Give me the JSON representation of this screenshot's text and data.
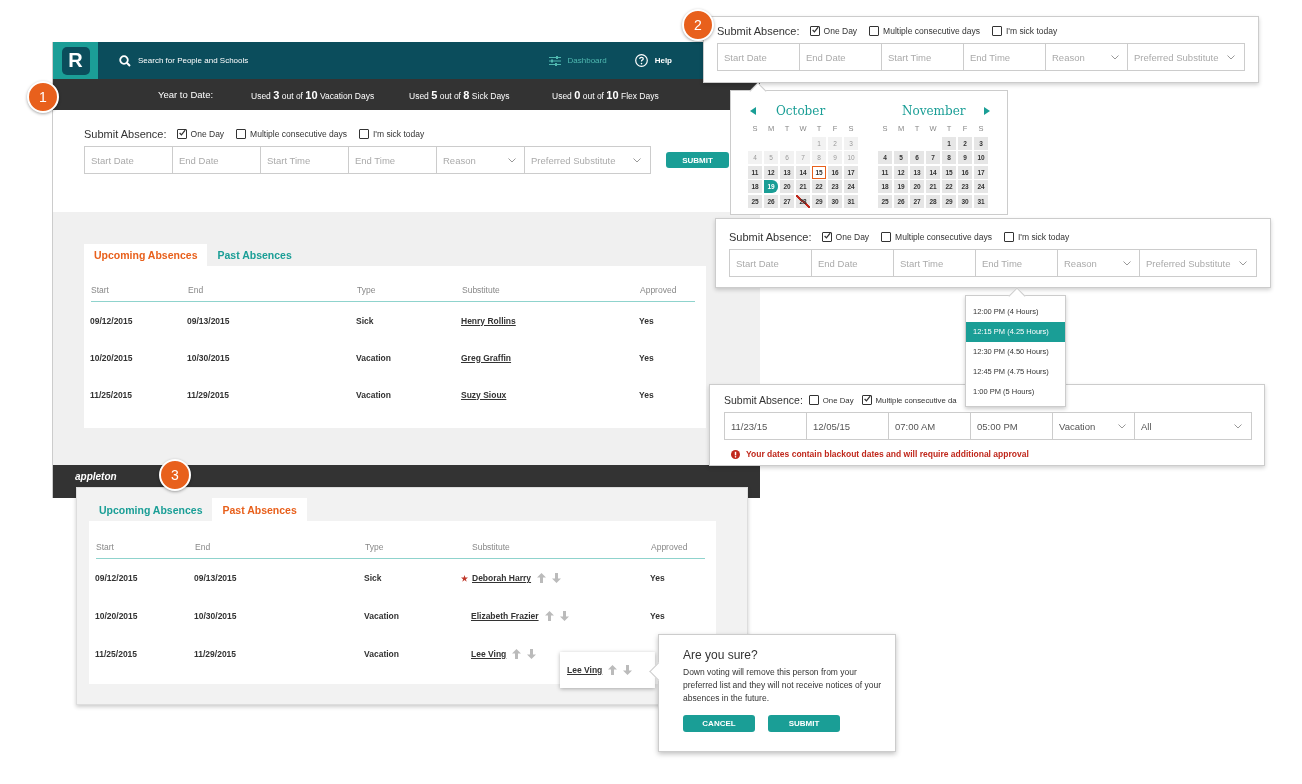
{
  "main_screen": {
    "badge": "1",
    "header": {
      "logo": "R",
      "search": {
        "placeholder": "Search for People and Schools"
      },
      "nav": [
        {
          "label": "Dashboard",
          "kind": "dashboard",
          "selected": true
        },
        {
          "label": "Help",
          "kind": "help",
          "selected": false
        }
      ]
    },
    "stats": {
      "title": "Year to Date:",
      "items": [
        "Used **3** out of **10** Vacation Days",
        "Used **5** out of **8** Sick Days",
        "Used **0** out of **10** Flex Days"
      ]
    },
    "form": {
      "label": "Submit Absence:",
      "options": [
        {
          "label": "One Day",
          "checked": true
        },
        {
          "label": "Multiple consecutive days",
          "checked": false
        },
        {
          "label": "I'm sick today",
          "checked": false
        }
      ],
      "fields": [
        {
          "kind": "text",
          "placeholder": "Start Date"
        },
        {
          "kind": "text",
          "placeholder": "End Date"
        },
        {
          "kind": "text",
          "placeholder": "Start Time"
        },
        {
          "kind": "text",
          "placeholder": "End Time"
        },
        {
          "kind": "select",
          "placeholder": "Reason"
        },
        {
          "kind": "select",
          "placeholder": "Preferred Substitute"
        }
      ],
      "submit": "SUBMIT"
    },
    "tabs": [
      {
        "label": "Upcoming Absences",
        "selected": true
      },
      {
        "label": "Past Absences",
        "selected": false
      }
    ],
    "table": {
      "columns": [
        "Start",
        "End",
        "Type",
        "Substitute",
        "Approved"
      ],
      "rows": [
        {
          "start": "09/12/2015",
          "end": "09/13/2015",
          "type": "Sick",
          "substitute": "Henry Rollins",
          "approved": "Yes"
        },
        {
          "start": "10/20/2015",
          "end": "10/30/2015",
          "type": "Vacation",
          "substitute": "Greg Graffin",
          "approved": "Yes"
        },
        {
          "start": "11/25/2015",
          "end": "11/29/2015",
          "type": "Vacation",
          "substitute": "Suzy Sioux",
          "approved": "Yes"
        }
      ]
    },
    "footer": {
      "logo": "appleton"
    }
  },
  "calendar_form": {
    "badge": "2",
    "form": {
      "label": "Submit Absence:",
      "options": [
        {
          "label": "One Day",
          "checked": true
        },
        {
          "label": "Multiple consecutive days",
          "checked": false
        },
        {
          "label": "I'm sick today",
          "checked": false
        }
      ],
      "fields": [
        {
          "kind": "text",
          "placeholder": "Start Date"
        },
        {
          "kind": "text",
          "placeholder": "End Date"
        },
        {
          "kind": "text",
          "placeholder": "Start Time"
        },
        {
          "kind": "text",
          "placeholder": "End Time"
        },
        {
          "kind": "select",
          "placeholder": "Reason"
        },
        {
          "kind": "select",
          "placeholder": "Preferred Substitute"
        }
      ]
    },
    "calendar": {
      "months": [
        {
          "name": "October",
          "weekdays": [
            "S",
            "M",
            "T",
            "W",
            "T",
            "F",
            "S"
          ],
          "weeks": [
            [
              {
                "day": "1",
                "kind": "disabled",
                "selected": false
              },
              {
                "day": "2",
                "kind": "disabled",
                "selected": false
              },
              {
                "day": "3",
                "kind": "disabled",
                "selected": false
              }
            ],
            [
              {
                "day": "4",
                "kind": "disabled",
                "selected": false
              },
              {
                "day": "5",
                "kind": "disabled",
                "selected": false
              },
              {
                "day": "6",
                "kind": "disabled",
                "selected": false
              },
              {
                "day": "7",
                "kind": "disabled",
                "selected": false
              },
              {
                "day": "8",
                "kind": "disabled",
                "selected": false
              },
              {
                "day": "9",
                "kind": "disabled",
                "selected": false
              },
              {
                "day": "10",
                "kind": "disabled",
                "selected": false
              }
            ],
            [
              {
                "day": "11",
                "kind": "normal",
                "selected": false
              },
              {
                "day": "12",
                "kind": "normal",
                "selected": false
              },
              {
                "day": "13",
                "kind": "normal",
                "selected": false
              },
              {
                "day": "14",
                "kind": "normal",
                "selected": false
              },
              {
                "day": "15",
                "kind": "today",
                "selected": false
              },
              {
                "day": "16",
                "kind": "normal",
                "selected": false
              },
              {
                "day": "17",
                "kind": "normal",
                "selected": false
              }
            ],
            [
              {
                "day": "18",
                "kind": "normal",
                "selected": false
              },
              {
                "day": "19",
                "kind": "normal",
                "selected": true
              },
              {
                "day": "20",
                "kind": "normal",
                "selected": false
              },
              {
                "day": "21",
                "kind": "normal",
                "selected": false
              },
              {
                "day": "22",
                "kind": "normal",
                "selected": false
              },
              {
                "day": "23",
                "kind": "normal",
                "selected": false
              },
              {
                "day": "24",
                "kind": "normal",
                "selected": false
              }
            ],
            [
              {
                "day": "25",
                "kind": "normal",
                "selected": false
              },
              {
                "day": "26",
                "kind": "normal",
                "selected": false
              },
              {
                "day": "27",
                "kind": "normal",
                "selected": false
              },
              {
                "day": "28",
                "kind": "blackout",
                "selected": false
              },
              {
                "day": "29",
                "kind": "normal",
                "selected": false
              },
              {
                "day": "30",
                "kind": "normal",
                "selected": false
              },
              {
                "day": "31",
                "kind": "normal",
                "selected": false
              }
            ]
          ]
        },
        {
          "name": "November",
          "weekdays": [
            "S",
            "M",
            "T",
            "W",
            "T",
            "F",
            "S"
          ],
          "weeks": [
            [
              {
                "day": "1",
                "kind": "normal",
                "selected": false
              },
              {
                "day": "2",
                "kind": "normal",
                "selected": false
              },
              {
                "day": "3",
                "kind": "normal",
                "selected": false
              }
            ],
            [
              {
                "day": "4",
                "kind": "normal",
                "selected": false
              },
              {
                "day": "5",
                "kind": "normal",
                "selected": false
              },
              {
                "day": "6",
                "kind": "normal",
                "selected": false
              },
              {
                "day": "7",
                "kind": "normal",
                "selected": false
              },
              {
                "day": "8",
                "kind": "normal",
                "selected": false
              },
              {
                "day": "9",
                "kind": "normal",
                "selected": false
              },
              {
                "day": "10",
                "kind": "normal",
                "selected": false
              }
            ],
            [
              {
                "day": "11",
                "kind": "normal",
                "selected": false
              },
              {
                "day": "12",
                "kind": "normal",
                "selected": false
              },
              {
                "day": "13",
                "kind": "normal",
                "selected": false
              },
              {
                "day": "14",
                "kind": "normal",
                "selected": false
              },
              {
                "day": "15",
                "kind": "normal",
                "selected": false
              },
              {
                "day": "16",
                "kind": "normal",
                "selected": false
              },
              {
                "day": "17",
                "kind": "normal",
                "selected": false
              }
            ],
            [
              {
                "day": "18",
                "kind": "normal",
                "selected": false
              },
              {
                "day": "19",
                "kind": "normal",
                "selected": false
              },
              {
                "day": "20",
                "kind": "normal",
                "selected": false
              },
              {
                "day": "21",
                "kind": "normal",
                "selected": false
              },
              {
                "day": "22",
                "kind": "normal",
                "selected": false
              },
              {
                "day": "23",
                "kind": "normal",
                "selected": false
              },
              {
                "day": "24",
                "kind": "normal",
                "selected": false
              }
            ],
            [
              {
                "day": "25",
                "kind": "normal",
                "selected": false
              },
              {
                "day": "26",
                "kind": "normal",
                "selected": false
              },
              {
                "day": "27",
                "kind": "normal",
                "selected": false
              },
              {
                "day": "28",
                "kind": "normal",
                "selected": false
              },
              {
                "day": "29",
                "kind": "normal",
                "selected": false
              },
              {
                "day": "30",
                "kind": "normal",
                "selected": false
              },
              {
                "day": "31",
                "kind": "normal",
                "selected": false
              }
            ]
          ]
        }
      ]
    }
  },
  "end_time_form": {
    "form": {
      "label": "Submit Absence:",
      "options": [
        {
          "label": "One Day",
          "checked": true
        },
        {
          "label": "Multiple consecutive days",
          "checked": false
        },
        {
          "label": "I'm sick today",
          "checked": false
        }
      ],
      "fields": [
        {
          "kind": "text",
          "placeholder": "Start Date"
        },
        {
          "kind": "text",
          "placeholder": "End Date"
        },
        {
          "kind": "text",
          "placeholder": "Start Time"
        },
        {
          "kind": "text",
          "placeholder": "End Time"
        },
        {
          "kind": "select",
          "placeholder": "Reason"
        },
        {
          "kind": "select",
          "placeholder": "Preferred Substitute"
        }
      ]
    },
    "time_options": [
      {
        "label": "12:00 PM (4 Hours)",
        "selected": false
      },
      {
        "label": "12:15 PM (4.25 Hours)",
        "selected": true
      },
      {
        "label": "12:30 PM (4.50 Hours)",
        "selected": false
      },
      {
        "label": "12:45 PM (4.75 Hours)",
        "selected": false
      },
      {
        "label": "1:00 PM (5 Hours)",
        "selected": false
      }
    ]
  },
  "multi_day_form": {
    "form": {
      "label": "Submit Absence:",
      "options": [
        {
          "label": "One Day",
          "checked": false
        },
        {
          "label": "Multiple consecutive da",
          "checked": true
        }
      ],
      "fields": [
        {
          "kind": "text",
          "value": "11/23/15"
        },
        {
          "kind": "text",
          "value": "12/05/15"
        },
        {
          "kind": "text",
          "value": "07:00 AM"
        },
        {
          "kind": "text",
          "value": "05:00 PM"
        },
        {
          "kind": "select",
          "value": "Vacation"
        },
        {
          "kind": "select",
          "value": "All"
        }
      ]
    },
    "error": "Your dates contain blackout dates and will require additional approval"
  },
  "past_absences": {
    "badge": "3",
    "tabs": [
      {
        "label": "Upcoming Absences",
        "selected": false
      },
      {
        "label": "Past Absences",
        "selected": true
      }
    ],
    "table": {
      "kind": "votable",
      "columns": [
        "Start",
        "End",
        "Type",
        "Substitute",
        "Approved"
      ],
      "rows": [
        {
          "start": "09/12/2015",
          "end": "09/13/2015",
          "type": "Sick",
          "substitute": "Deborah Harry",
          "starred": true,
          "approved": "Yes"
        },
        {
          "start": "10/20/2015",
          "end": "10/30/2015",
          "type": "Vacation",
          "substitute": "Elizabeth Frazier",
          "starred": false,
          "approved": "Yes"
        },
        {
          "start": "11/25/2015",
          "end": "11/29/2015",
          "type": "Vacation",
          "substitute": "Lee Ving",
          "starred": false
        }
      ]
    }
  },
  "vote_popover": {
    "name": "Lee Ving"
  },
  "confirm_dialog": {
    "title": "Are you sure?",
    "message": "Down voting will remove this person from your preferred list and they will not receive notices of your absences in the future.",
    "buttons": [
      "CANCEL",
      "SUBMIT"
    ]
  }
}
